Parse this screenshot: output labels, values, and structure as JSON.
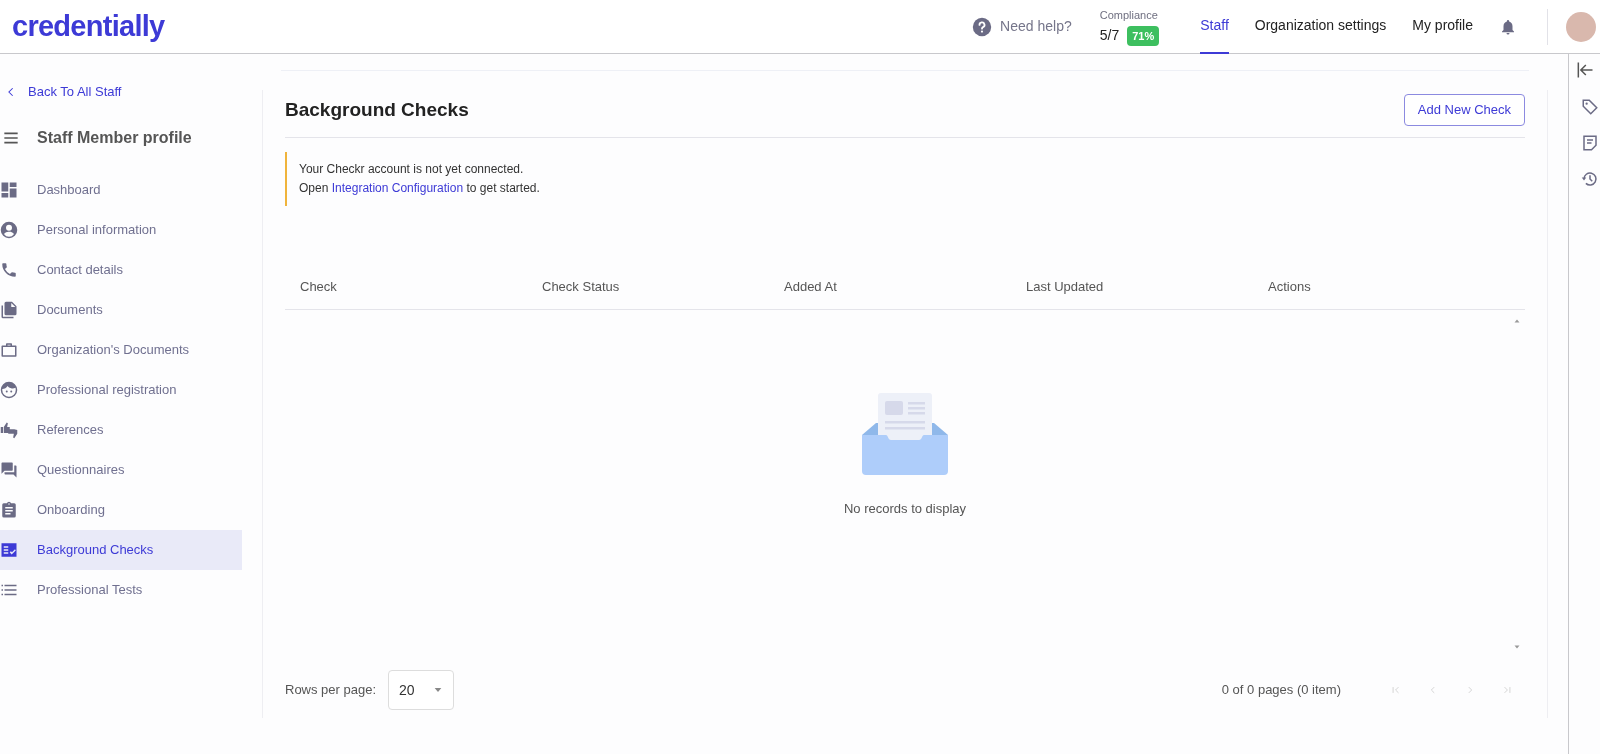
{
  "header": {
    "logo": "credentially",
    "help": "Need help?",
    "compliance": {
      "label": "Compliance",
      "count": "5/7",
      "percent": "71%"
    },
    "nav": [
      {
        "label": "Staff",
        "selected": true
      },
      {
        "label": "Organization settings",
        "selected": false
      },
      {
        "label": "My profile",
        "selected": false
      }
    ]
  },
  "sidebar": {
    "back": "Back To All Staff",
    "title": "Staff Member profile",
    "items": [
      {
        "label": "Dashboard",
        "selected": false
      },
      {
        "label": "Personal information",
        "selected": false
      },
      {
        "label": "Contact details",
        "selected": false
      },
      {
        "label": "Documents",
        "selected": false
      },
      {
        "label": "Organization's Documents",
        "selected": false
      },
      {
        "label": "Professional registration",
        "selected": false
      },
      {
        "label": "References",
        "selected": false
      },
      {
        "label": "Questionnaires",
        "selected": false
      },
      {
        "label": "Onboarding",
        "selected": false
      },
      {
        "label": "Background Checks",
        "selected": true
      },
      {
        "label": "Professional Tests",
        "selected": false
      }
    ]
  },
  "main": {
    "title": "Background Checks",
    "add_button": "Add New Check",
    "alert": {
      "line1": "Your Checkr account is not yet connected.",
      "line2_before": "Open",
      "link": "Integration Configuration",
      "line2_after": "to get started."
    },
    "table": {
      "columns": [
        "Check",
        "Check Status",
        "Added At",
        "Last Updated",
        "Actions"
      ],
      "empty": "No records to display"
    },
    "footer": {
      "rows_label": "Rows per page:",
      "rows_value": "20",
      "pages": "0 of 0 pages (0 item)"
    }
  }
}
